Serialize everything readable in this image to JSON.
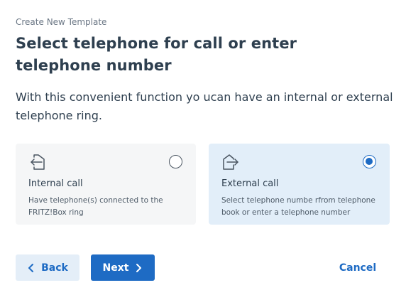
{
  "header": {
    "eyebrow": "Create New Template",
    "title": "Select telephone for call or enter telephone number"
  },
  "description": "With this convenient function yo ucan have an internal or external telephone ring.",
  "options": [
    {
      "id": "internal",
      "icon": "arrow-left-into-box-icon",
      "title": "Internal call",
      "text": "Have telephone(s) connected to the FRITZ!Box ring",
      "selected": false
    },
    {
      "id": "external",
      "icon": "arrow-right-out-of-box-icon",
      "title": "External call",
      "text": "Select telephone numbe rfrom telephone book or enter a telephone number",
      "selected": true
    }
  ],
  "buttons": {
    "back": "Back",
    "next": "Next",
    "cancel": "Cancel"
  },
  "colors": {
    "accent": "#1e6bc4",
    "selected_card_bg": "#e2eef9",
    "card_bg": "#f5f6f7",
    "text": "#2e3f4f"
  }
}
